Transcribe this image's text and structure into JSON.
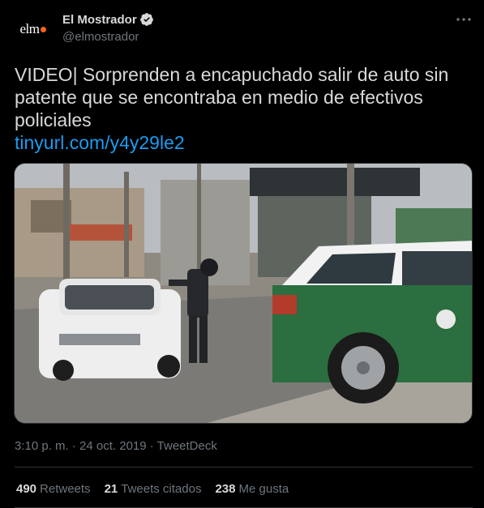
{
  "author": {
    "avatar_text": "elm",
    "display_name": "El Mostrador",
    "handle": "@elmostrador",
    "verified_icon": "verified-badge-icon"
  },
  "tweet": {
    "text": "VIDEO| Sorprenden a encapuchado salir de auto sin patente que se encontraba en medio de efectivos policiales",
    "link": "tinyurl.com/y4y29le2"
  },
  "meta": {
    "timestamp": "3:10 p. m. · 24 oct. 2019 · TweetDeck"
  },
  "stats": {
    "retweets_count": "490",
    "retweets_label": "Retweets",
    "quotes_count": "21",
    "quotes_label": "Tweets citados",
    "likes_count": "238",
    "likes_label": "Me gusta"
  },
  "colors": {
    "background": "#000000",
    "link": "#1d9bf0",
    "secondary_text": "#6e767d",
    "brand_dot": "#f26522"
  }
}
